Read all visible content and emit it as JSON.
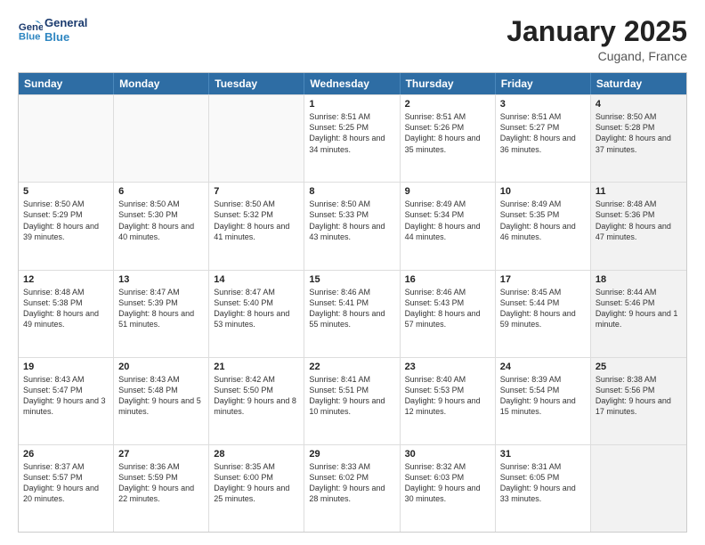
{
  "header": {
    "logo_line1": "General",
    "logo_line2": "Blue",
    "month": "January 2025",
    "location": "Cugand, France"
  },
  "weekdays": [
    "Sunday",
    "Monday",
    "Tuesday",
    "Wednesday",
    "Thursday",
    "Friday",
    "Saturday"
  ],
  "rows": [
    [
      {
        "day": "",
        "sunrise": "",
        "sunset": "",
        "daylight": "",
        "shaded": false,
        "empty": true
      },
      {
        "day": "",
        "sunrise": "",
        "sunset": "",
        "daylight": "",
        "shaded": false,
        "empty": true
      },
      {
        "day": "",
        "sunrise": "",
        "sunset": "",
        "daylight": "",
        "shaded": false,
        "empty": true
      },
      {
        "day": "1",
        "sunrise": "Sunrise: 8:51 AM",
        "sunset": "Sunset: 5:25 PM",
        "daylight": "Daylight: 8 hours and 34 minutes.",
        "shaded": false,
        "empty": false
      },
      {
        "day": "2",
        "sunrise": "Sunrise: 8:51 AM",
        "sunset": "Sunset: 5:26 PM",
        "daylight": "Daylight: 8 hours and 35 minutes.",
        "shaded": false,
        "empty": false
      },
      {
        "day": "3",
        "sunrise": "Sunrise: 8:51 AM",
        "sunset": "Sunset: 5:27 PM",
        "daylight": "Daylight: 8 hours and 36 minutes.",
        "shaded": false,
        "empty": false
      },
      {
        "day": "4",
        "sunrise": "Sunrise: 8:50 AM",
        "sunset": "Sunset: 5:28 PM",
        "daylight": "Daylight: 8 hours and 37 minutes.",
        "shaded": true,
        "empty": false
      }
    ],
    [
      {
        "day": "5",
        "sunrise": "Sunrise: 8:50 AM",
        "sunset": "Sunset: 5:29 PM",
        "daylight": "Daylight: 8 hours and 39 minutes.",
        "shaded": false,
        "empty": false
      },
      {
        "day": "6",
        "sunrise": "Sunrise: 8:50 AM",
        "sunset": "Sunset: 5:30 PM",
        "daylight": "Daylight: 8 hours and 40 minutes.",
        "shaded": false,
        "empty": false
      },
      {
        "day": "7",
        "sunrise": "Sunrise: 8:50 AM",
        "sunset": "Sunset: 5:32 PM",
        "daylight": "Daylight: 8 hours and 41 minutes.",
        "shaded": false,
        "empty": false
      },
      {
        "day": "8",
        "sunrise": "Sunrise: 8:50 AM",
        "sunset": "Sunset: 5:33 PM",
        "daylight": "Daylight: 8 hours and 43 minutes.",
        "shaded": false,
        "empty": false
      },
      {
        "day": "9",
        "sunrise": "Sunrise: 8:49 AM",
        "sunset": "Sunset: 5:34 PM",
        "daylight": "Daylight: 8 hours and 44 minutes.",
        "shaded": false,
        "empty": false
      },
      {
        "day": "10",
        "sunrise": "Sunrise: 8:49 AM",
        "sunset": "Sunset: 5:35 PM",
        "daylight": "Daylight: 8 hours and 46 minutes.",
        "shaded": false,
        "empty": false
      },
      {
        "day": "11",
        "sunrise": "Sunrise: 8:48 AM",
        "sunset": "Sunset: 5:36 PM",
        "daylight": "Daylight: 8 hours and 47 minutes.",
        "shaded": true,
        "empty": false
      }
    ],
    [
      {
        "day": "12",
        "sunrise": "Sunrise: 8:48 AM",
        "sunset": "Sunset: 5:38 PM",
        "daylight": "Daylight: 8 hours and 49 minutes.",
        "shaded": false,
        "empty": false
      },
      {
        "day": "13",
        "sunrise": "Sunrise: 8:47 AM",
        "sunset": "Sunset: 5:39 PM",
        "daylight": "Daylight: 8 hours and 51 minutes.",
        "shaded": false,
        "empty": false
      },
      {
        "day": "14",
        "sunrise": "Sunrise: 8:47 AM",
        "sunset": "Sunset: 5:40 PM",
        "daylight": "Daylight: 8 hours and 53 minutes.",
        "shaded": false,
        "empty": false
      },
      {
        "day": "15",
        "sunrise": "Sunrise: 8:46 AM",
        "sunset": "Sunset: 5:41 PM",
        "daylight": "Daylight: 8 hours and 55 minutes.",
        "shaded": false,
        "empty": false
      },
      {
        "day": "16",
        "sunrise": "Sunrise: 8:46 AM",
        "sunset": "Sunset: 5:43 PM",
        "daylight": "Daylight: 8 hours and 57 minutes.",
        "shaded": false,
        "empty": false
      },
      {
        "day": "17",
        "sunrise": "Sunrise: 8:45 AM",
        "sunset": "Sunset: 5:44 PM",
        "daylight": "Daylight: 8 hours and 59 minutes.",
        "shaded": false,
        "empty": false
      },
      {
        "day": "18",
        "sunrise": "Sunrise: 8:44 AM",
        "sunset": "Sunset: 5:46 PM",
        "daylight": "Daylight: 9 hours and 1 minute.",
        "shaded": true,
        "empty": false
      }
    ],
    [
      {
        "day": "19",
        "sunrise": "Sunrise: 8:43 AM",
        "sunset": "Sunset: 5:47 PM",
        "daylight": "Daylight: 9 hours and 3 minutes.",
        "shaded": false,
        "empty": false
      },
      {
        "day": "20",
        "sunrise": "Sunrise: 8:43 AM",
        "sunset": "Sunset: 5:48 PM",
        "daylight": "Daylight: 9 hours and 5 minutes.",
        "shaded": false,
        "empty": false
      },
      {
        "day": "21",
        "sunrise": "Sunrise: 8:42 AM",
        "sunset": "Sunset: 5:50 PM",
        "daylight": "Daylight: 9 hours and 8 minutes.",
        "shaded": false,
        "empty": false
      },
      {
        "day": "22",
        "sunrise": "Sunrise: 8:41 AM",
        "sunset": "Sunset: 5:51 PM",
        "daylight": "Daylight: 9 hours and 10 minutes.",
        "shaded": false,
        "empty": false
      },
      {
        "day": "23",
        "sunrise": "Sunrise: 8:40 AM",
        "sunset": "Sunset: 5:53 PM",
        "daylight": "Daylight: 9 hours and 12 minutes.",
        "shaded": false,
        "empty": false
      },
      {
        "day": "24",
        "sunrise": "Sunrise: 8:39 AM",
        "sunset": "Sunset: 5:54 PM",
        "daylight": "Daylight: 9 hours and 15 minutes.",
        "shaded": false,
        "empty": false
      },
      {
        "day": "25",
        "sunrise": "Sunrise: 8:38 AM",
        "sunset": "Sunset: 5:56 PM",
        "daylight": "Daylight: 9 hours and 17 minutes.",
        "shaded": true,
        "empty": false
      }
    ],
    [
      {
        "day": "26",
        "sunrise": "Sunrise: 8:37 AM",
        "sunset": "Sunset: 5:57 PM",
        "daylight": "Daylight: 9 hours and 20 minutes.",
        "shaded": false,
        "empty": false
      },
      {
        "day": "27",
        "sunrise": "Sunrise: 8:36 AM",
        "sunset": "Sunset: 5:59 PM",
        "daylight": "Daylight: 9 hours and 22 minutes.",
        "shaded": false,
        "empty": false
      },
      {
        "day": "28",
        "sunrise": "Sunrise: 8:35 AM",
        "sunset": "Sunset: 6:00 PM",
        "daylight": "Daylight: 9 hours and 25 minutes.",
        "shaded": false,
        "empty": false
      },
      {
        "day": "29",
        "sunrise": "Sunrise: 8:33 AM",
        "sunset": "Sunset: 6:02 PM",
        "daylight": "Daylight: 9 hours and 28 minutes.",
        "shaded": false,
        "empty": false
      },
      {
        "day": "30",
        "sunrise": "Sunrise: 8:32 AM",
        "sunset": "Sunset: 6:03 PM",
        "daylight": "Daylight: 9 hours and 30 minutes.",
        "shaded": false,
        "empty": false
      },
      {
        "day": "31",
        "sunrise": "Sunrise: 8:31 AM",
        "sunset": "Sunset: 6:05 PM",
        "daylight": "Daylight: 9 hours and 33 minutes.",
        "shaded": false,
        "empty": false
      },
      {
        "day": "",
        "sunrise": "",
        "sunset": "",
        "daylight": "",
        "shaded": true,
        "empty": true
      }
    ]
  ]
}
